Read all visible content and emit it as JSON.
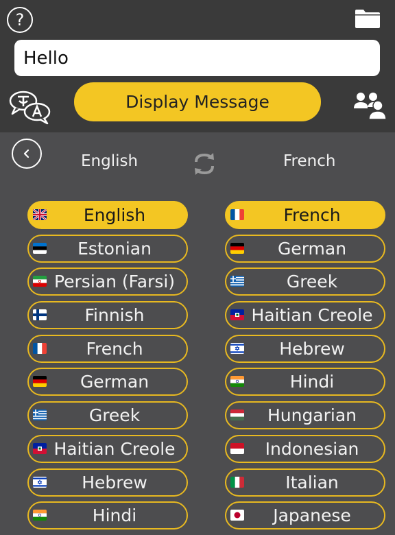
{
  "header": {
    "help_icon": "question-mark-icon",
    "help_glyph": "?",
    "folder_icon": "folder-icon",
    "message_value": "Hello",
    "translate_icon": "translate-speech-icon",
    "display_label": "Display Message",
    "group_icon": "people-group-icon"
  },
  "selector": {
    "back_icon": "chevron-left-icon",
    "from_language": "English",
    "swap_icon": "swap-arrows-icon",
    "to_language": "French"
  },
  "colors": {
    "accent": "#f3c623",
    "background": "#4d4d4f",
    "header_background": "#3a3a3a"
  },
  "source_languages": [
    {
      "label": "English",
      "flag": "uk",
      "selected": true
    },
    {
      "label": "Estonian",
      "flag": "estonia",
      "selected": false
    },
    {
      "label": "Persian (Farsi)",
      "flag": "iran",
      "selected": false
    },
    {
      "label": "Finnish",
      "flag": "finland",
      "selected": false
    },
    {
      "label": "French",
      "flag": "france",
      "selected": false
    },
    {
      "label": "German",
      "flag": "germany",
      "selected": false
    },
    {
      "label": "Greek",
      "flag": "greece",
      "selected": false
    },
    {
      "label": "Haitian Creole",
      "flag": "haiti",
      "selected": false
    },
    {
      "label": "Hebrew",
      "flag": "israel",
      "selected": false
    },
    {
      "label": "Hindi",
      "flag": "india",
      "selected": false
    }
  ],
  "target_languages": [
    {
      "label": "French",
      "flag": "france",
      "selected": true
    },
    {
      "label": "German",
      "flag": "germany",
      "selected": false
    },
    {
      "label": "Greek",
      "flag": "greece",
      "selected": false
    },
    {
      "label": "Haitian Creole",
      "flag": "haiti",
      "selected": false
    },
    {
      "label": "Hebrew",
      "flag": "israel",
      "selected": false
    },
    {
      "label": "Hindi",
      "flag": "india",
      "selected": false
    },
    {
      "label": "Hungarian",
      "flag": "hungary",
      "selected": false
    },
    {
      "label": "Indonesian",
      "flag": "indonesia",
      "selected": false
    },
    {
      "label": "Italian",
      "flag": "italy",
      "selected": false
    },
    {
      "label": "Japanese",
      "flag": "japan",
      "selected": false
    }
  ]
}
